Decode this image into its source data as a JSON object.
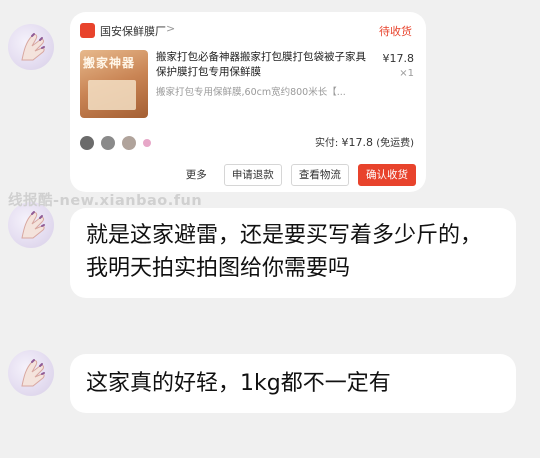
{
  "order_card": {
    "shop_name": "国安保鲜膜厂",
    "shop_chevron": ">",
    "status": "待收货",
    "product_image_text": "搬家神器",
    "product_title": "搬家打包必备神器搬家打包膜打包袋被子家具保护膜打包专用保鲜膜",
    "product_spec": "搬家打包专用保鲜膜,60cm宽约800米长【...",
    "price": "¥17.8",
    "quantity": "×1",
    "paid_label": "实付:",
    "paid_amount": "¥17.8",
    "paid_note": "(免运费)",
    "buttons": {
      "more": "更多",
      "refund": "申请退款",
      "logistics": "查看物流",
      "confirm": "确认收货"
    },
    "accent_color": "#e8432c"
  },
  "watermark": "线报酷-new.xianbao.fun",
  "messages": [
    {
      "text": "就是这家避雷，还是要买写着多少斤的，我明天拍实拍图给你需要吗"
    },
    {
      "text": "这家真的好轻，1kg都不一定有"
    }
  ],
  "colors": {
    "background": "#f0f0f0",
    "bubble": "#ffffff",
    "avatar": "#e5def1"
  }
}
